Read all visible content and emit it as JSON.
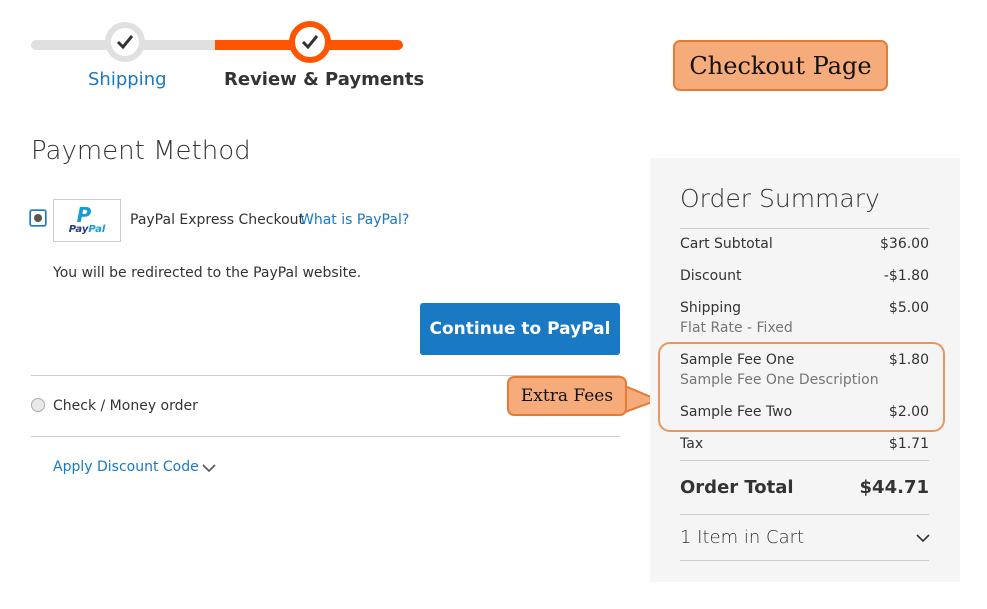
{
  "progress": {
    "steps": [
      {
        "label": "Shipping",
        "state": "completed"
      },
      {
        "label": "Review & Payments",
        "state": "active"
      }
    ]
  },
  "annotations": {
    "page_callout": "Checkout Page",
    "fees_callout": "Extra Fees"
  },
  "payment": {
    "title": "Payment Method",
    "paypal": {
      "logo_mark": "P",
      "logo_word_a": "Pay",
      "logo_word_b": "Pal",
      "label": "PayPal Express Checkout",
      "info_link": "What is PayPal?",
      "redirect_note": "You will be redirected to the PayPal website.",
      "button": "Continue to PayPal",
      "selected": true
    },
    "check_money": {
      "label": "Check / Money order",
      "selected": false
    },
    "discount_link": "Apply Discount Code"
  },
  "summary": {
    "title": "Order Summary",
    "rows": {
      "subtotal": {
        "label": "Cart Subtotal",
        "value": "$36.00"
      },
      "discount": {
        "label": "Discount",
        "value": "-$1.80"
      },
      "shipping": {
        "label": "Shipping",
        "value": "$5.00",
        "sub": "Flat Rate - Fixed"
      },
      "fee1": {
        "label": "Sample Fee One",
        "value": "$1.80",
        "sub": "Sample Fee One Description"
      },
      "fee2": {
        "label": "Sample Fee Two",
        "value": "$2.00"
      },
      "tax": {
        "label": "Tax",
        "value": "$1.71"
      },
      "total": {
        "label": "Order Total",
        "value": "$44.71"
      }
    },
    "cart_items": "1 Item in Cart"
  },
  "colors": {
    "accent_orange": "#ff5501",
    "link_blue": "#1979c3",
    "callout_fill": "#f6ab7a"
  }
}
